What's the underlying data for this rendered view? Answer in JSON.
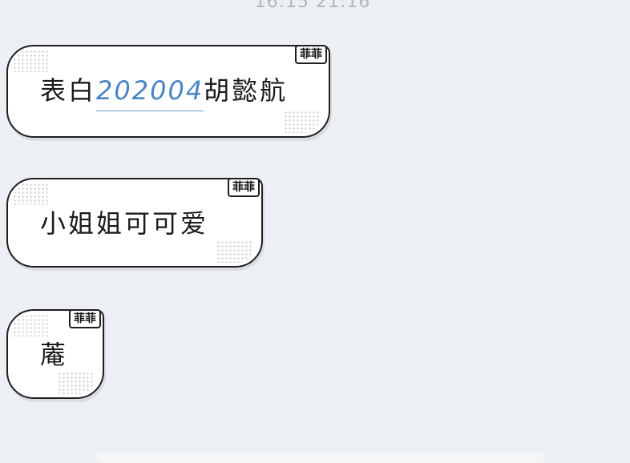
{
  "timestamp": "16:15 21:16",
  "messages": [
    {
      "prefix": "表白",
      "link": "202004",
      "suffix": "胡懿航",
      "tag": "菲菲"
    },
    {
      "text": "小姐姐可可爱",
      "tag": "菲菲"
    },
    {
      "text": "蓭",
      "tag": "菲菲"
    }
  ]
}
